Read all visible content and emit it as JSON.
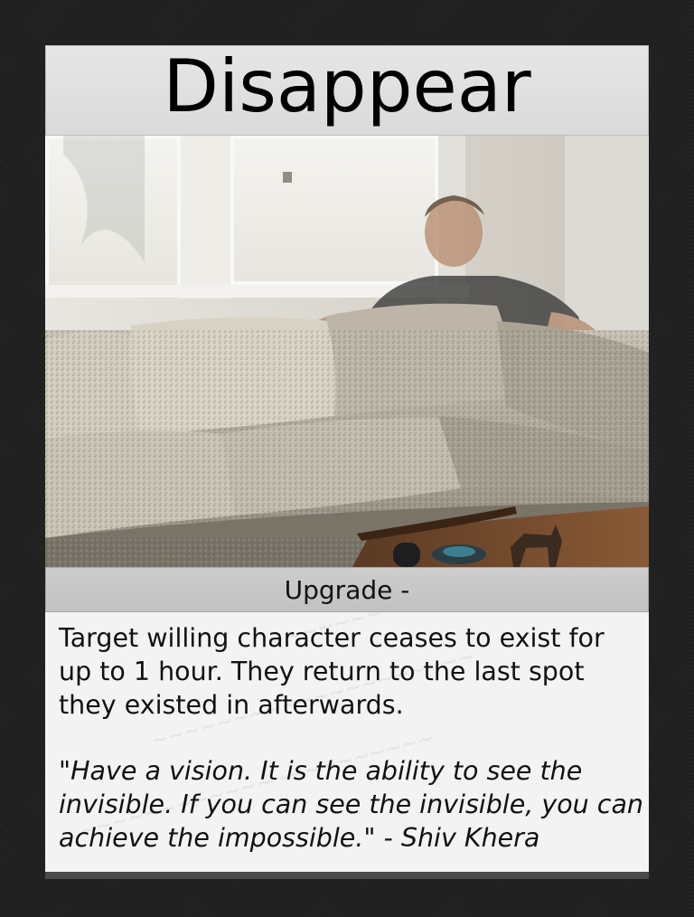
{
  "card": {
    "title": "Disappear",
    "type_line": "Upgrade -",
    "rules_text": "Target willing character ceases to exist for up to 1 hour. They return to the last spot they existed in afterwards.",
    "flavor_text": "\"Have a vision. It is the ability to see the invisible. If you can see the invisible, you can achieve the impossible.\" - Shiv Khera",
    "art_description_icon": "photo-man-on-couch-icon"
  },
  "colors": {
    "frame": "#222222",
    "title_bar": "#e0e0e0",
    "type_bar": "#c6c6c6",
    "text_box": "#f3f3f3"
  }
}
